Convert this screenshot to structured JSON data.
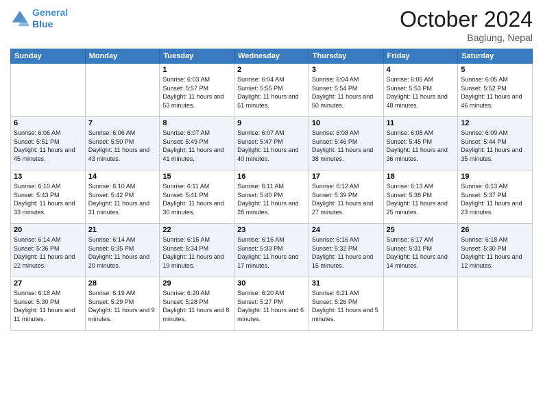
{
  "header": {
    "logo_line1": "General",
    "logo_line2": "Blue",
    "month_title": "October 2024",
    "subtitle": "Baglung, Nepal"
  },
  "days_of_week": [
    "Sunday",
    "Monday",
    "Tuesday",
    "Wednesday",
    "Thursday",
    "Friday",
    "Saturday"
  ],
  "weeks": [
    [
      {
        "day": "",
        "info": ""
      },
      {
        "day": "",
        "info": ""
      },
      {
        "day": "1",
        "info": "Sunrise: 6:03 AM\nSunset: 5:57 PM\nDaylight: 11 hours and 53 minutes."
      },
      {
        "day": "2",
        "info": "Sunrise: 6:04 AM\nSunset: 5:55 PM\nDaylight: 11 hours and 51 minutes."
      },
      {
        "day": "3",
        "info": "Sunrise: 6:04 AM\nSunset: 5:54 PM\nDaylight: 11 hours and 50 minutes."
      },
      {
        "day": "4",
        "info": "Sunrise: 6:05 AM\nSunset: 5:53 PM\nDaylight: 11 hours and 48 minutes."
      },
      {
        "day": "5",
        "info": "Sunrise: 6:05 AM\nSunset: 5:52 PM\nDaylight: 11 hours and 46 minutes."
      }
    ],
    [
      {
        "day": "6",
        "info": "Sunrise: 6:06 AM\nSunset: 5:51 PM\nDaylight: 11 hours and 45 minutes."
      },
      {
        "day": "7",
        "info": "Sunrise: 6:06 AM\nSunset: 5:50 PM\nDaylight: 11 hours and 43 minutes."
      },
      {
        "day": "8",
        "info": "Sunrise: 6:07 AM\nSunset: 5:49 PM\nDaylight: 11 hours and 41 minutes."
      },
      {
        "day": "9",
        "info": "Sunrise: 6:07 AM\nSunset: 5:47 PM\nDaylight: 11 hours and 40 minutes."
      },
      {
        "day": "10",
        "info": "Sunrise: 6:08 AM\nSunset: 5:46 PM\nDaylight: 11 hours and 38 minutes."
      },
      {
        "day": "11",
        "info": "Sunrise: 6:08 AM\nSunset: 5:45 PM\nDaylight: 11 hours and 36 minutes."
      },
      {
        "day": "12",
        "info": "Sunrise: 6:09 AM\nSunset: 5:44 PM\nDaylight: 11 hours and 35 minutes."
      }
    ],
    [
      {
        "day": "13",
        "info": "Sunrise: 6:10 AM\nSunset: 5:43 PM\nDaylight: 11 hours and 33 minutes."
      },
      {
        "day": "14",
        "info": "Sunrise: 6:10 AM\nSunset: 5:42 PM\nDaylight: 11 hours and 31 minutes."
      },
      {
        "day": "15",
        "info": "Sunrise: 6:11 AM\nSunset: 5:41 PM\nDaylight: 11 hours and 30 minutes."
      },
      {
        "day": "16",
        "info": "Sunrise: 6:11 AM\nSunset: 5:40 PM\nDaylight: 11 hours and 28 minutes."
      },
      {
        "day": "17",
        "info": "Sunrise: 6:12 AM\nSunset: 5:39 PM\nDaylight: 11 hours and 27 minutes."
      },
      {
        "day": "18",
        "info": "Sunrise: 6:13 AM\nSunset: 5:38 PM\nDaylight: 11 hours and 25 minutes."
      },
      {
        "day": "19",
        "info": "Sunrise: 6:13 AM\nSunset: 5:37 PM\nDaylight: 11 hours and 23 minutes."
      }
    ],
    [
      {
        "day": "20",
        "info": "Sunrise: 6:14 AM\nSunset: 5:36 PM\nDaylight: 11 hours and 22 minutes."
      },
      {
        "day": "21",
        "info": "Sunrise: 6:14 AM\nSunset: 5:35 PM\nDaylight: 11 hours and 20 minutes."
      },
      {
        "day": "22",
        "info": "Sunrise: 6:15 AM\nSunset: 5:34 PM\nDaylight: 11 hours and 19 minutes."
      },
      {
        "day": "23",
        "info": "Sunrise: 6:16 AM\nSunset: 5:33 PM\nDaylight: 11 hours and 17 minutes."
      },
      {
        "day": "24",
        "info": "Sunrise: 6:16 AM\nSunset: 5:32 PM\nDaylight: 11 hours and 15 minutes."
      },
      {
        "day": "25",
        "info": "Sunrise: 6:17 AM\nSunset: 5:31 PM\nDaylight: 11 hours and 14 minutes."
      },
      {
        "day": "26",
        "info": "Sunrise: 6:18 AM\nSunset: 5:30 PM\nDaylight: 11 hours and 12 minutes."
      }
    ],
    [
      {
        "day": "27",
        "info": "Sunrise: 6:18 AM\nSunset: 5:30 PM\nDaylight: 11 hours and 11 minutes."
      },
      {
        "day": "28",
        "info": "Sunrise: 6:19 AM\nSunset: 5:29 PM\nDaylight: 11 hours and 9 minutes."
      },
      {
        "day": "29",
        "info": "Sunrise: 6:20 AM\nSunset: 5:28 PM\nDaylight: 11 hours and 8 minutes."
      },
      {
        "day": "30",
        "info": "Sunrise: 6:20 AM\nSunset: 5:27 PM\nDaylight: 11 hours and 6 minutes."
      },
      {
        "day": "31",
        "info": "Sunrise: 6:21 AM\nSunset: 5:26 PM\nDaylight: 11 hours and 5 minutes."
      },
      {
        "day": "",
        "info": ""
      },
      {
        "day": "",
        "info": ""
      }
    ]
  ]
}
